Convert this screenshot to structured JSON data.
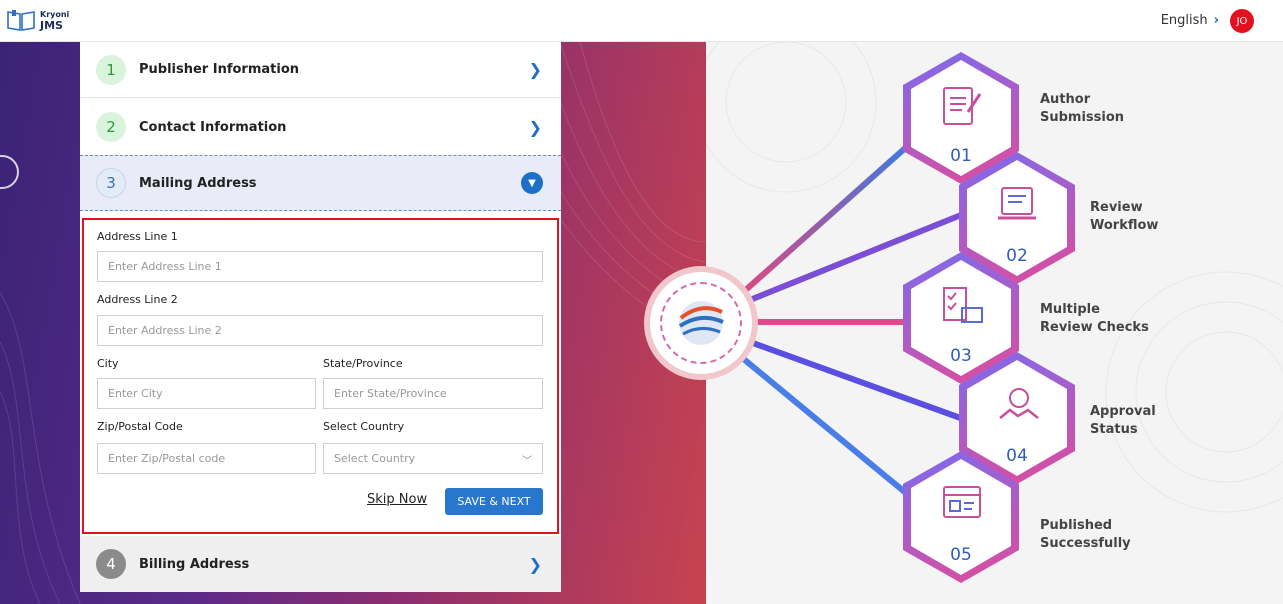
{
  "header": {
    "logo_small": "Kryoni",
    "logo_big": "JMS",
    "language": "English",
    "avatar_initials": "JO"
  },
  "steps": [
    {
      "number": "1",
      "title": "Publisher Information"
    },
    {
      "number": "2",
      "title": "Contact Information"
    },
    {
      "number": "3",
      "title": "Mailing Address"
    },
    {
      "number": "4",
      "title": "Billing Address"
    }
  ],
  "form": {
    "address1": {
      "label": "Address Line 1",
      "placeholder": "Enter Address Line 1"
    },
    "address2": {
      "label": "Address Line 2",
      "placeholder": "Enter Address Line 2"
    },
    "city": {
      "label": "City",
      "placeholder": "Enter City"
    },
    "state": {
      "label": "State/Province",
      "placeholder": "Enter State/Province"
    },
    "zip": {
      "label": "Zip/Postal Code",
      "placeholder": "Enter Zip/Postal code"
    },
    "country": {
      "label": "Select Country",
      "placeholder": "Select Country"
    },
    "skip_label": "Skip Now",
    "save_label": "SAVE & NEXT"
  },
  "workflow": [
    {
      "number": "01",
      "line1": "Author",
      "line2": "Submission",
      "icon": "author-submission-icon"
    },
    {
      "number": "02",
      "line1": "Review",
      "line2": "Workflow",
      "icon": "review-workflow-icon"
    },
    {
      "number": "03",
      "line1": "Multiple",
      "line2": "Review Checks",
      "icon": "review-checks-icon"
    },
    {
      "number": "04",
      "line1": "Approval",
      "line2": "Status",
      "icon": "approval-handshake-icon"
    },
    {
      "number": "05",
      "line1": "Published",
      "line2": "Successfully",
      "icon": "published-icon"
    }
  ],
  "colors": {
    "accent": "#2777cf",
    "error_border": "#d8161e",
    "avatar": "#e4101e"
  }
}
